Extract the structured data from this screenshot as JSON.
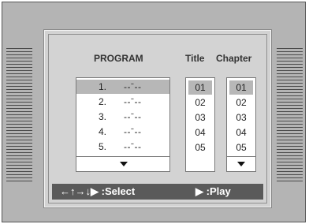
{
  "header": {
    "program": "PROGRAM",
    "title": "Title",
    "chapter": "Chapter"
  },
  "program_list": {
    "rows": [
      {
        "num": "1.",
        "value": "--ˉ--"
      },
      {
        "num": "2.",
        "value": "--ˉ--"
      },
      {
        "num": "3.",
        "value": "--ˉ--"
      },
      {
        "num": "4.",
        "value": "--ˉ--"
      },
      {
        "num": "5.",
        "value": "--ˉ--"
      }
    ],
    "selected_index": 0
  },
  "title_list": {
    "items": [
      "01",
      "02",
      "03",
      "04",
      "05"
    ],
    "selected_index": 0
  },
  "chapter_list": {
    "items": [
      "01",
      "02",
      "03",
      "04",
      "05"
    ],
    "selected_index": 0
  },
  "footer": {
    "select_hint": "←↑→↓▶ :Select",
    "play_hint": "▶ :Play"
  },
  "icons": {
    "scroll_down": "triangle-down-icon"
  }
}
